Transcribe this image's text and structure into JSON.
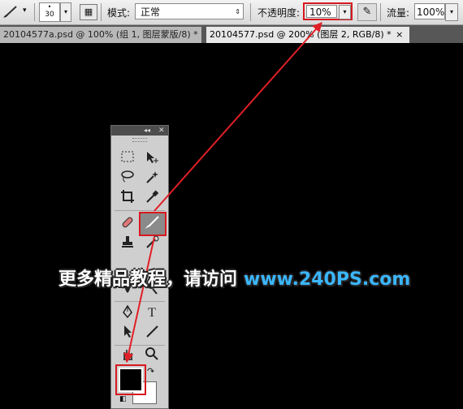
{
  "options_bar": {
    "brush_size": "30",
    "brush_dot": "•",
    "mode_label": "模式:",
    "mode_value": "正常",
    "opacity_label": "不透明度:",
    "opacity_value": "10%",
    "flow_label": "流量:",
    "flow_value": "100%",
    "dropdown_arrow": "▾",
    "select_arrows": "⇕"
  },
  "tabs": [
    {
      "label": "20104577a.psd @ 100% (组 1, 图层蒙版/8) *",
      "close": "×"
    },
    {
      "label": "20104577.psd @ 200% (图层 2, RGB/8) *",
      "close": "×"
    }
  ],
  "tools_panel": {
    "collapse": "◂◂",
    "close": "✕",
    "text_tool": "T"
  },
  "watermark": {
    "text": "更多精品教程，请访问",
    "url": "www.240PS.com"
  },
  "colors": {
    "highlight": "#d71920",
    "canvas": "#000000",
    "watermark_url": "#3bb6ff"
  }
}
